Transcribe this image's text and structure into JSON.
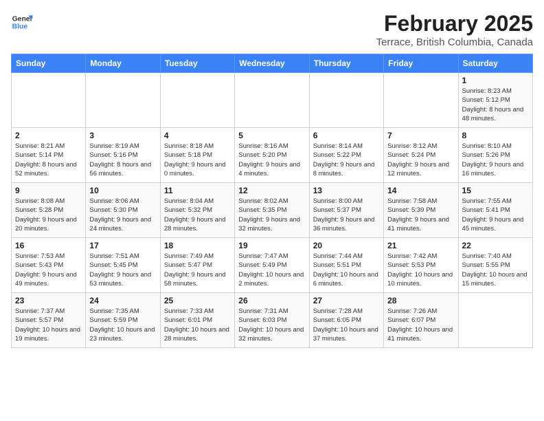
{
  "logo": {
    "general": "General",
    "blue": "Blue"
  },
  "header": {
    "title": "February 2025",
    "subtitle": "Terrace, British Columbia, Canada"
  },
  "weekdays": [
    "Sunday",
    "Monday",
    "Tuesday",
    "Wednesday",
    "Thursday",
    "Friday",
    "Saturday"
  ],
  "weeks": [
    [
      {
        "day": "",
        "info": ""
      },
      {
        "day": "",
        "info": ""
      },
      {
        "day": "",
        "info": ""
      },
      {
        "day": "",
        "info": ""
      },
      {
        "day": "",
        "info": ""
      },
      {
        "day": "",
        "info": ""
      },
      {
        "day": "1",
        "info": "Sunrise: 8:23 AM\nSunset: 5:12 PM\nDaylight: 8 hours and 48 minutes."
      }
    ],
    [
      {
        "day": "2",
        "info": "Sunrise: 8:21 AM\nSunset: 5:14 PM\nDaylight: 8 hours and 52 minutes."
      },
      {
        "day": "3",
        "info": "Sunrise: 8:19 AM\nSunset: 5:16 PM\nDaylight: 8 hours and 56 minutes."
      },
      {
        "day": "4",
        "info": "Sunrise: 8:18 AM\nSunset: 5:18 PM\nDaylight: 9 hours and 0 minutes."
      },
      {
        "day": "5",
        "info": "Sunrise: 8:16 AM\nSunset: 5:20 PM\nDaylight: 9 hours and 4 minutes."
      },
      {
        "day": "6",
        "info": "Sunrise: 8:14 AM\nSunset: 5:22 PM\nDaylight: 9 hours and 8 minutes."
      },
      {
        "day": "7",
        "info": "Sunrise: 8:12 AM\nSunset: 5:24 PM\nDaylight: 9 hours and 12 minutes."
      },
      {
        "day": "8",
        "info": "Sunrise: 8:10 AM\nSunset: 5:26 PM\nDaylight: 9 hours and 16 minutes."
      }
    ],
    [
      {
        "day": "9",
        "info": "Sunrise: 8:08 AM\nSunset: 5:28 PM\nDaylight: 9 hours and 20 minutes."
      },
      {
        "day": "10",
        "info": "Sunrise: 8:06 AM\nSunset: 5:30 PM\nDaylight: 9 hours and 24 minutes."
      },
      {
        "day": "11",
        "info": "Sunrise: 8:04 AM\nSunset: 5:32 PM\nDaylight: 9 hours and 28 minutes."
      },
      {
        "day": "12",
        "info": "Sunrise: 8:02 AM\nSunset: 5:35 PM\nDaylight: 9 hours and 32 minutes."
      },
      {
        "day": "13",
        "info": "Sunrise: 8:00 AM\nSunset: 5:37 PM\nDaylight: 9 hours and 36 minutes."
      },
      {
        "day": "14",
        "info": "Sunrise: 7:58 AM\nSunset: 5:39 PM\nDaylight: 9 hours and 41 minutes."
      },
      {
        "day": "15",
        "info": "Sunrise: 7:55 AM\nSunset: 5:41 PM\nDaylight: 9 hours and 45 minutes."
      }
    ],
    [
      {
        "day": "16",
        "info": "Sunrise: 7:53 AM\nSunset: 5:43 PM\nDaylight: 9 hours and 49 minutes."
      },
      {
        "day": "17",
        "info": "Sunrise: 7:51 AM\nSunset: 5:45 PM\nDaylight: 9 hours and 53 minutes."
      },
      {
        "day": "18",
        "info": "Sunrise: 7:49 AM\nSunset: 5:47 PM\nDaylight: 9 hours and 58 minutes."
      },
      {
        "day": "19",
        "info": "Sunrise: 7:47 AM\nSunset: 5:49 PM\nDaylight: 10 hours and 2 minutes."
      },
      {
        "day": "20",
        "info": "Sunrise: 7:44 AM\nSunset: 5:51 PM\nDaylight: 10 hours and 6 minutes."
      },
      {
        "day": "21",
        "info": "Sunrise: 7:42 AM\nSunset: 5:53 PM\nDaylight: 10 hours and 10 minutes."
      },
      {
        "day": "22",
        "info": "Sunrise: 7:40 AM\nSunset: 5:55 PM\nDaylight: 10 hours and 15 minutes."
      }
    ],
    [
      {
        "day": "23",
        "info": "Sunrise: 7:37 AM\nSunset: 5:57 PM\nDaylight: 10 hours and 19 minutes."
      },
      {
        "day": "24",
        "info": "Sunrise: 7:35 AM\nSunset: 5:59 PM\nDaylight: 10 hours and 23 minutes."
      },
      {
        "day": "25",
        "info": "Sunrise: 7:33 AM\nSunset: 6:01 PM\nDaylight: 10 hours and 28 minutes."
      },
      {
        "day": "26",
        "info": "Sunrise: 7:31 AM\nSunset: 6:03 PM\nDaylight: 10 hours and 32 minutes."
      },
      {
        "day": "27",
        "info": "Sunrise: 7:28 AM\nSunset: 6:05 PM\nDaylight: 10 hours and 37 minutes."
      },
      {
        "day": "28",
        "info": "Sunrise: 7:26 AM\nSunset: 6:07 PM\nDaylight: 10 hours and 41 minutes."
      },
      {
        "day": "",
        "info": ""
      }
    ]
  ]
}
